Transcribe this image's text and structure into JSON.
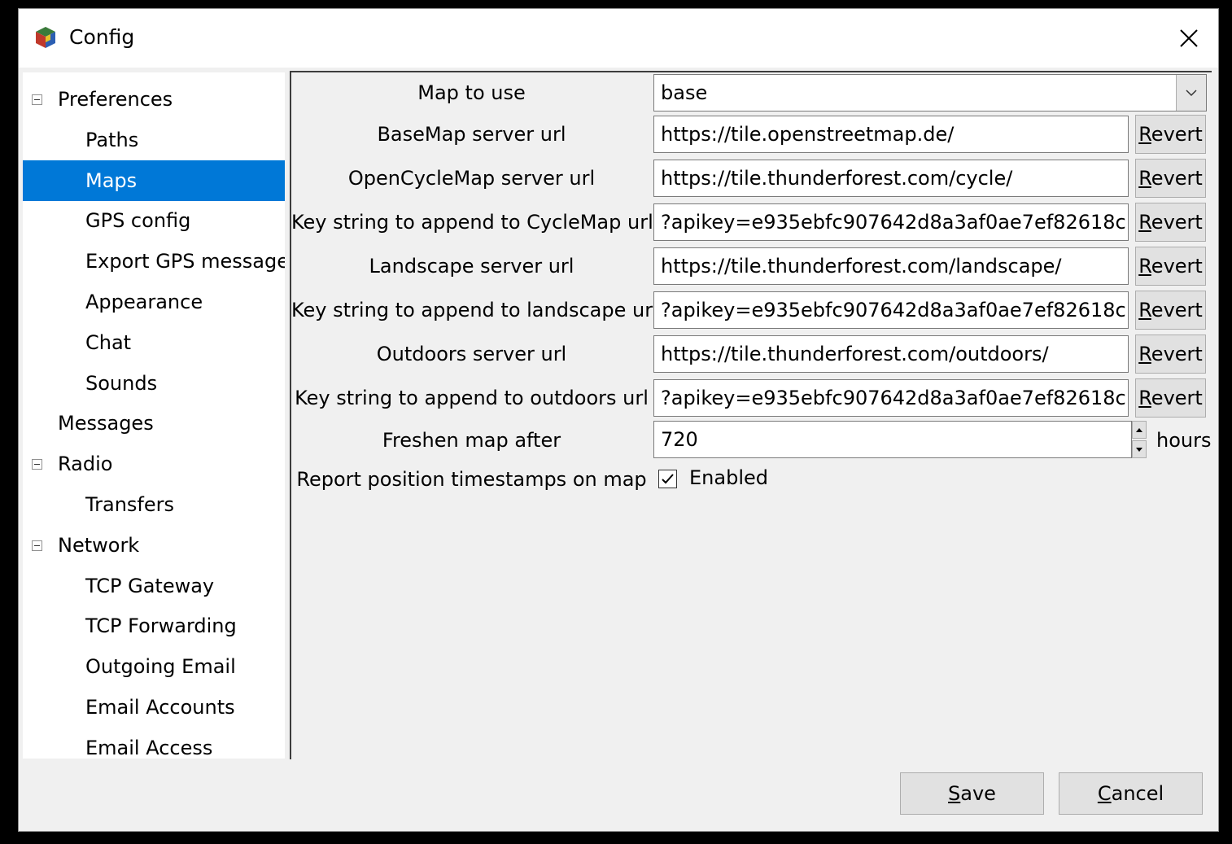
{
  "window": {
    "title": "Config"
  },
  "tree": {
    "items": [
      {
        "label": "Preferences",
        "level": 0,
        "expander": true
      },
      {
        "label": "Paths",
        "level": 1
      },
      {
        "label": "Maps",
        "level": 1,
        "selected": true
      },
      {
        "label": "GPS config",
        "level": 1
      },
      {
        "label": "Export GPS messages",
        "level": 1
      },
      {
        "label": "Appearance",
        "level": 1
      },
      {
        "label": "Chat",
        "level": 1
      },
      {
        "label": "Sounds",
        "level": 1
      },
      {
        "label": "Messages",
        "level": 0
      },
      {
        "label": "Radio",
        "level": 0,
        "expander": true
      },
      {
        "label": "Transfers",
        "level": 1
      },
      {
        "label": "Network",
        "level": 0,
        "expander": true
      },
      {
        "label": "TCP Gateway",
        "level": 1
      },
      {
        "label": "TCP Forwarding",
        "level": 1
      },
      {
        "label": "Outgoing Email",
        "level": 1
      },
      {
        "label": "Email Accounts",
        "level": 1
      },
      {
        "label": "Email Access",
        "level": 1
      }
    ]
  },
  "form": {
    "map_to_use": {
      "label": "Map to use",
      "value": "base"
    },
    "rows": [
      {
        "label": "BaseMap server url",
        "value": "https://tile.openstreetmap.de/",
        "button": "Revert"
      },
      {
        "label": "OpenCycleMap server url",
        "value": "https://tile.thunderforest.com/cycle/",
        "button": "Revert"
      },
      {
        "label": "Key string to append to CycleMap url",
        "value": "?apikey=e935ebfc907642d8a3af0ae7ef82618c",
        "button": "Revert"
      },
      {
        "label": "Landscape server url",
        "value": "https://tile.thunderforest.com/landscape/",
        "button": "Revert"
      },
      {
        "label": "Key string to append to landscape url",
        "value": "?apikey=e935ebfc907642d8a3af0ae7ef82618c",
        "button": "Revert"
      },
      {
        "label": "Outdoors server url",
        "value": "https://tile.thunderforest.com/outdoors/",
        "button": "Revert"
      },
      {
        "label": "Key string to append to outdoors url",
        "value": "?apikey=e935ebfc907642d8a3af0ae7ef82618c",
        "button": "Revert"
      }
    ],
    "freshen": {
      "label": "Freshen map after",
      "value": "720",
      "unit": "hours"
    },
    "report": {
      "label": "Report position timestamps on map",
      "checkbox_label": "Enabled",
      "checked": true
    }
  },
  "buttons": {
    "save": "Save",
    "cancel": "Cancel"
  },
  "colors": {
    "selection": "#0078d7",
    "window_bg": "#f0f0f0"
  }
}
